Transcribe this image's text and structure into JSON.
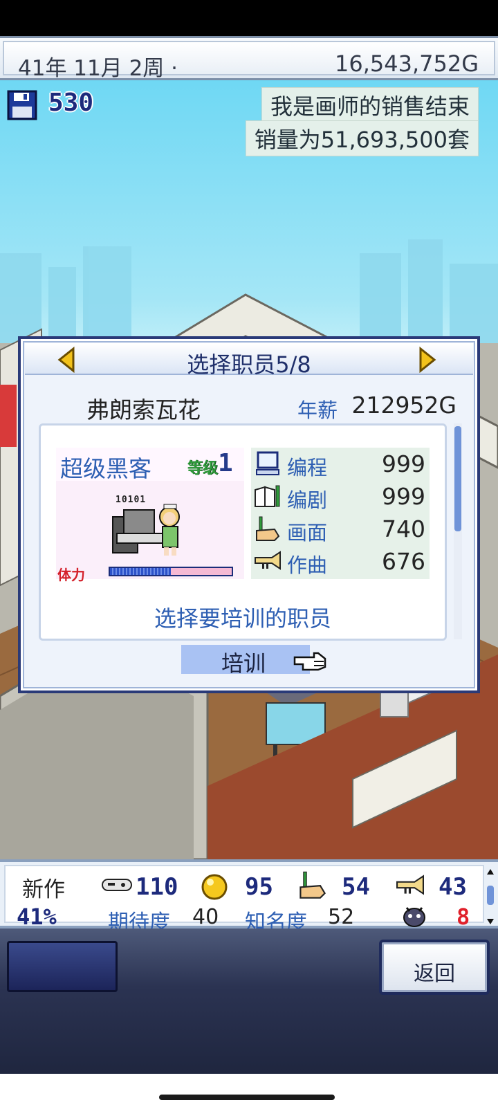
{
  "status_bar": {
    "date": "41年 11月 2周 ·",
    "money": "16,543,752G"
  },
  "scene": {
    "save_count": "530",
    "notice_line1": "我是画师的销售结束",
    "notice_line2": "销量为51,693,500套"
  },
  "dialog": {
    "title": "选择职员5/8",
    "employee_name": "弗朗索瓦花",
    "salary_label": "年薪",
    "salary_value": "212952G",
    "card": {
      "job_title": "超级黑客",
      "level_label": "等级",
      "level_value": "1",
      "binary": "10101",
      "stamina_label": "体力",
      "stamina_level": 0.5
    },
    "stats": [
      {
        "icon": "computer-icon",
        "label": "编程",
        "value": "999"
      },
      {
        "icon": "book-pen-icon",
        "label": "编剧",
        "value": "999"
      },
      {
        "icon": "paint-hand-icon",
        "label": "画面",
        "value": "740"
      },
      {
        "icon": "trumpet-icon",
        "label": "作曲",
        "value": "676"
      }
    ],
    "hint": "选择要培训的职员",
    "train_button": "培训"
  },
  "info_bar": {
    "new_label": "新作",
    "percent": "41%",
    "fun_value": "110",
    "creativity_value": "95",
    "graphics_value": "54",
    "sound_value": "43",
    "expectation_label": "期待度",
    "expectation_value": "40",
    "fame_label": "知名度",
    "fame_value": "52",
    "bug_count": "8"
  },
  "bottom_menu": {
    "back_button": "返回"
  },
  "colors": {
    "accent_blue": "#2e5fb3",
    "dialog_border": "#2a3a78",
    "stamina_red": "#d4202a",
    "level_green": "#2f9a3b"
  }
}
